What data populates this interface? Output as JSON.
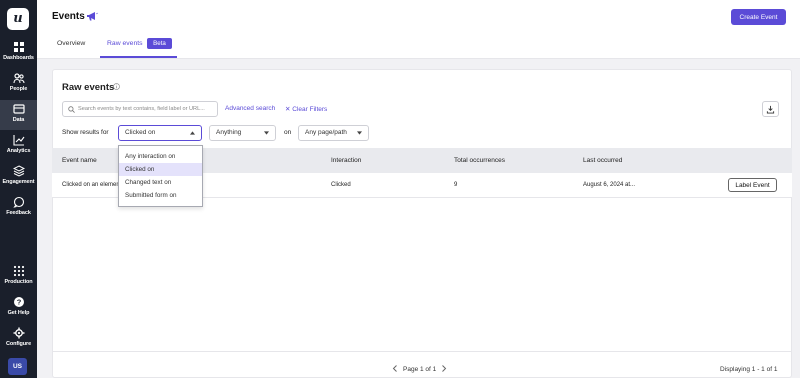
{
  "sidebar": {
    "logo": "u",
    "items": [
      {
        "label": "Dashboards",
        "icon": "grid-icon"
      },
      {
        "label": "People",
        "icon": "people-icon"
      },
      {
        "label": "Data",
        "icon": "data-icon"
      },
      {
        "label": "Analytics",
        "icon": "chart-icon"
      },
      {
        "label": "Engagement",
        "icon": "layers-icon"
      },
      {
        "label": "Feedback",
        "icon": "chat-icon"
      }
    ],
    "bottom_items": [
      {
        "label": "Production",
        "icon": "apps-icon"
      },
      {
        "label": "Get Help",
        "icon": "help-icon"
      },
      {
        "label": "Configure",
        "icon": "gear-icon"
      }
    ],
    "avatar": "US"
  },
  "header": {
    "title": "Events",
    "create_button": "Create Event",
    "tabs": [
      {
        "label": "Overview"
      },
      {
        "label": "Raw events",
        "badge": "Beta",
        "active": true
      }
    ]
  },
  "panel": {
    "title": "Raw events",
    "search_placeholder": "Search events by text contains, field label or URL...",
    "advanced_search": "Advanced search",
    "clear_filters": "Clear Filters",
    "show_results_label": "Show results for",
    "interaction_select": "Clicked on",
    "text_select": "Anything",
    "on_label": "on",
    "page_select": "Any page/path",
    "dropdown_options": [
      "Any interaction on",
      "Clicked on",
      "Changed text on",
      "Submitted form on"
    ],
    "dropdown_selected": "Clicked on"
  },
  "table": {
    "columns": [
      "Event name",
      "Interaction",
      "Total occurrences",
      "Last occurred"
    ],
    "rows": [
      {
        "event_name": "Clicked on an element",
        "interaction": "Clicked",
        "total": "9",
        "last": "August 6, 2024 at...",
        "action": "Label Event"
      }
    ]
  },
  "footer": {
    "page_info": "Page 1 of 1",
    "displaying": "Displaying 1 - 1 of 1"
  },
  "colors": {
    "accent": "#5b4bd7",
    "sidebar": "#1a1f2b",
    "selected_option": "#e4e2fb"
  }
}
